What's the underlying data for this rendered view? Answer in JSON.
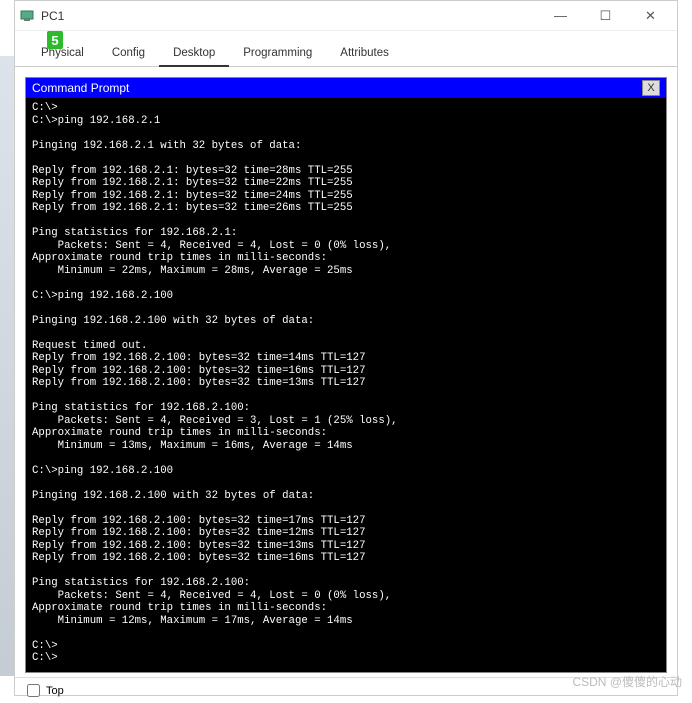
{
  "window": {
    "title": "PC1",
    "badge": "5"
  },
  "winControls": {
    "min": "—",
    "max": "☐",
    "close": "✕"
  },
  "tabs": {
    "t0": "Physical",
    "t1": "Config",
    "t2": "Desktop",
    "t3": "Programming",
    "t4": "Attributes"
  },
  "cmd": {
    "title": "Command Prompt",
    "close": "X",
    "output": "C:\\>\nC:\\>ping 192.168.2.1\n\nPinging 192.168.2.1 with 32 bytes of data:\n\nReply from 192.168.2.1: bytes=32 time=28ms TTL=255\nReply from 192.168.2.1: bytes=32 time=22ms TTL=255\nReply from 192.168.2.1: bytes=32 time=24ms TTL=255\nReply from 192.168.2.1: bytes=32 time=26ms TTL=255\n\nPing statistics for 192.168.2.1:\n    Packets: Sent = 4, Received = 4, Lost = 0 (0% loss),\nApproximate round trip times in milli-seconds:\n    Minimum = 22ms, Maximum = 28ms, Average = 25ms\n\nC:\\>ping 192.168.2.100\n\nPinging 192.168.2.100 with 32 bytes of data:\n\nRequest timed out.\nReply from 192.168.2.100: bytes=32 time=14ms TTL=127\nReply from 192.168.2.100: bytes=32 time=16ms TTL=127\nReply from 192.168.2.100: bytes=32 time=13ms TTL=127\n\nPing statistics for 192.168.2.100:\n    Packets: Sent = 4, Received = 3, Lost = 1 (25% loss),\nApproximate round trip times in milli-seconds:\n    Minimum = 13ms, Maximum = 16ms, Average = 14ms\n\nC:\\>ping 192.168.2.100\n\nPinging 192.168.2.100 with 32 bytes of data:\n\nReply from 192.168.2.100: bytes=32 time=17ms TTL=127\nReply from 192.168.2.100: bytes=32 time=12ms TTL=127\nReply from 192.168.2.100: bytes=32 time=13ms TTL=127\nReply from 192.168.2.100: bytes=32 time=16ms TTL=127\n\nPing statistics for 192.168.2.100:\n    Packets: Sent = 4, Received = 4, Lost = 0 (0% loss),\nApproximate round trip times in milli-seconds:\n    Minimum = 12ms, Maximum = 17ms, Average = 14ms\n\nC:\\>\nC:\\>"
  },
  "bottom": {
    "topLabel": "Top"
  },
  "watermark": "CSDN @傻傻的心动"
}
